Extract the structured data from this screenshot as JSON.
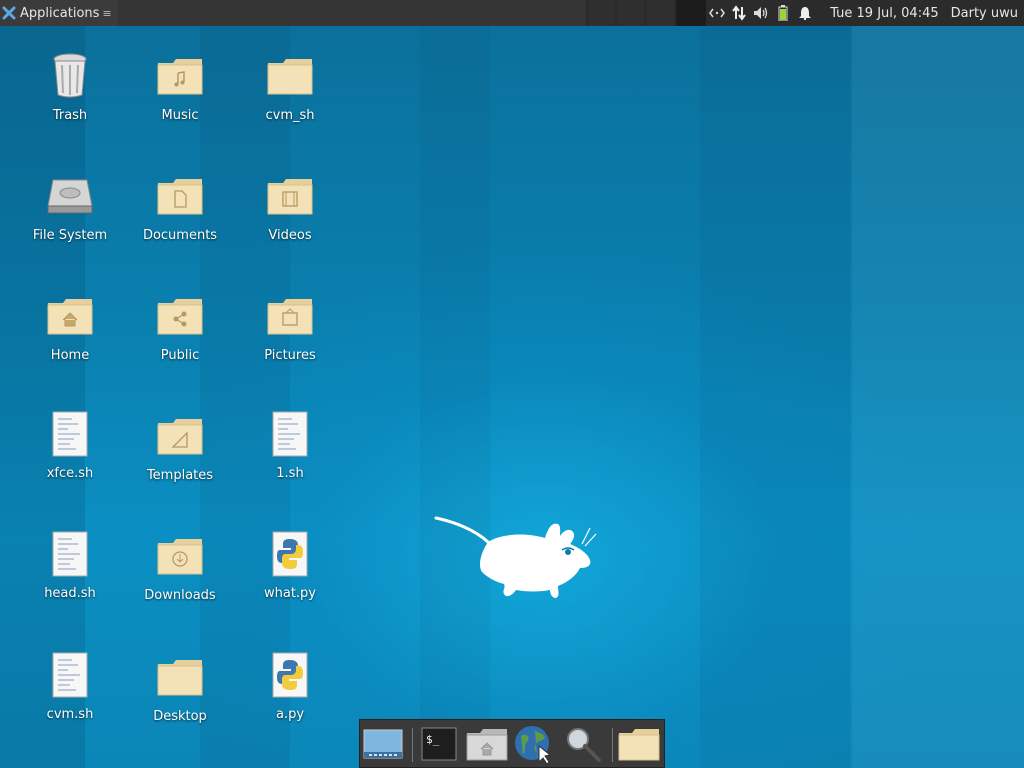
{
  "panel": {
    "app_menu_label": "Applications",
    "clock": "Tue 19 Jul, 04:45",
    "user": "Darty uwu",
    "tray_icons": [
      "network-code-icon",
      "transfer-icon",
      "volume-icon",
      "battery-icon",
      "notification-bell-icon"
    ]
  },
  "desktop": {
    "icons": [
      {
        "label": "Trash",
        "icon": "trash-icon"
      },
      {
        "label": "Music",
        "icon": "folder-music-icon"
      },
      {
        "label": "cvm_sh",
        "icon": "folder-icon"
      },
      {
        "label": "File System",
        "icon": "drive-icon"
      },
      {
        "label": "Documents",
        "icon": "folder-documents-icon"
      },
      {
        "label": "Videos",
        "icon": "folder-videos-icon"
      },
      {
        "label": "Home",
        "icon": "folder-home-icon"
      },
      {
        "label": "Public",
        "icon": "folder-public-icon"
      },
      {
        "label": "Pictures",
        "icon": "folder-pictures-icon"
      },
      {
        "label": "xfce.sh",
        "icon": "script-file-icon"
      },
      {
        "label": "Templates",
        "icon": "folder-templates-icon"
      },
      {
        "label": "1.sh",
        "icon": "script-file-icon"
      },
      {
        "label": "head.sh",
        "icon": "script-file-icon"
      },
      {
        "label": "Downloads",
        "icon": "folder-downloads-icon"
      },
      {
        "label": "what.py",
        "icon": "python-file-icon"
      },
      {
        "label": "cvm.sh",
        "icon": "script-file-icon"
      },
      {
        "label": "Desktop",
        "icon": "folder-icon"
      },
      {
        "label": "a.py",
        "icon": "python-file-icon"
      }
    ]
  },
  "dock": {
    "items": [
      "show-desktop-icon",
      "terminal-icon",
      "home-folder-icon",
      "web-browser-icon",
      "search-icon",
      "folder-icon"
    ]
  },
  "colors": {
    "panel_bg": "#2b2b2b",
    "desktop_blue": "#0b86b7",
    "folder": "#f1dcae"
  }
}
